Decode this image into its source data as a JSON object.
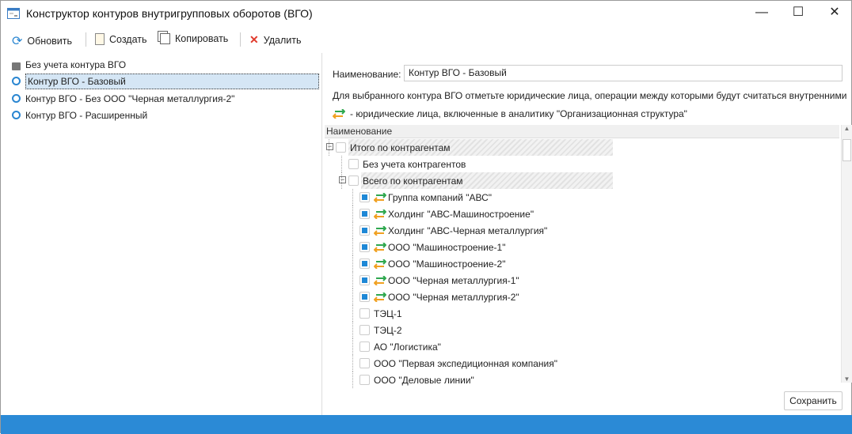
{
  "window": {
    "title": "Конструктор контуров внутригрупповых оборотов (ВГО)",
    "minimize": "—",
    "maximize": "☐",
    "close": "✕"
  },
  "toolbar": {
    "refresh": "Обновить",
    "create": "Создать",
    "copy": "Копировать",
    "delete": "Удалить"
  },
  "contours": [
    {
      "label": "Без учета контура ВГО",
      "icon": "lock-icon"
    },
    {
      "label": "Контур ВГО - Базовый",
      "icon": "radio-icon",
      "selected": true
    },
    {
      "label": "Контур ВГО - Без ООО \"Черная металлургия-2\"",
      "icon": "radio-icon"
    },
    {
      "label": "Контур ВГО - Расширенный",
      "icon": "radio-icon"
    }
  ],
  "form": {
    "name_label": "Наименование:",
    "name_value": "Контур ВГО - Базовый",
    "hint": "Для выбранного контура ВГО отметьте юридические лица, операции между которыми будут считаться внутренними",
    "legend": "- юридические лица, включенные в аналитику \"Организационная структура\""
  },
  "grid": {
    "header": "Наименование",
    "rows": [
      {
        "label": "Итого по контрагентам",
        "level": 0,
        "checked": false,
        "expander": "−",
        "group": true
      },
      {
        "label": "Без учета контрагентов",
        "level": 1,
        "checked": false
      },
      {
        "label": "Всего по контрагентам",
        "level": 1,
        "checked": false,
        "expander": "−",
        "group": true
      },
      {
        "label": "Группа компаний \"АВС\"",
        "level": 2,
        "checked": true,
        "entity": true
      },
      {
        "label": "Холдинг \"АВС-Машиностроение\"",
        "level": 2,
        "checked": true,
        "entity": true
      },
      {
        "label": "Холдинг \"АВС-Черная металлургия\"",
        "level": 2,
        "checked": true,
        "entity": true
      },
      {
        "label": "ООО \"Машиностроение-1\"",
        "level": 2,
        "checked": true,
        "entity": true
      },
      {
        "label": "ООО \"Машиностроение-2\"",
        "level": 2,
        "checked": true,
        "entity": true
      },
      {
        "label": "ООО \"Черная металлургия-1\"",
        "level": 2,
        "checked": true,
        "entity": true
      },
      {
        "label": "ООО \"Черная металлургия-2\"",
        "level": 2,
        "checked": true,
        "entity": true
      },
      {
        "label": "ТЭЦ-1",
        "level": 2,
        "checked": false
      },
      {
        "label": "ТЭЦ-2",
        "level": 2,
        "checked": false
      },
      {
        "label": "АО \"Логистика\"",
        "level": 2,
        "checked": false
      },
      {
        "label": "ООО \"Первая экспедиционная компания\"",
        "level": 2,
        "checked": false
      },
      {
        "label": "ООО \"Деловые линии\"",
        "level": 2,
        "checked": false
      }
    ]
  },
  "save": "Сохранить",
  "colors": {
    "accent": "#2b8ad6",
    "selection": "#d5e6f5"
  }
}
